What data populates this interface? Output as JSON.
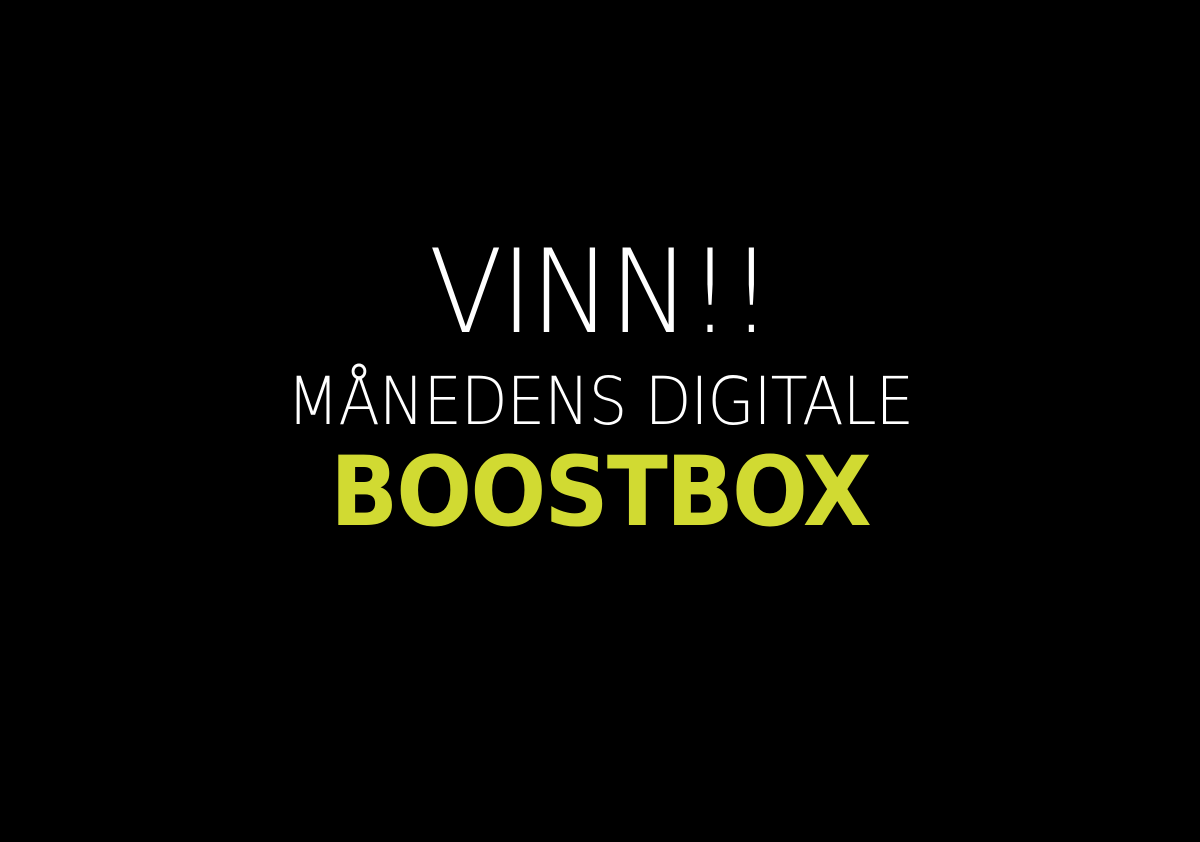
{
  "poster": {
    "line1": "VINN!!",
    "line2": "MÅNEDENS DIGITALE",
    "line3": "BOOSTBOX"
  },
  "colors": {
    "background": "#000000",
    "primary_text": "#ffffff",
    "accent": "#d1da32"
  }
}
